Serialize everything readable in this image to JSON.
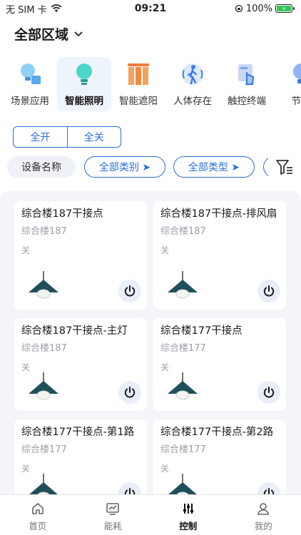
{
  "status": {
    "carrier": "无 SIM 卡",
    "time": "09:21",
    "battery": "100%"
  },
  "region": {
    "title": "全部区域"
  },
  "categories": [
    {
      "label": "场景应用",
      "icon": "scene-icon"
    },
    {
      "label": "智能照明",
      "icon": "bulb-icon",
      "active": true
    },
    {
      "label": "智能遮阳",
      "icon": "curtain-icon"
    },
    {
      "label": "人体存在",
      "icon": "person-presence-icon"
    },
    {
      "label": "触控终端",
      "icon": "touch-terminal-icon"
    },
    {
      "label": "节能",
      "icon": "energy-icon"
    }
  ],
  "switch_all": {
    "on": "全开",
    "off": "全关"
  },
  "filters": {
    "device_name": "设备名称",
    "category": "全部类别 ➤",
    "type": "全部类型 ➤"
  },
  "devices": [
    {
      "name": "综合楼187干接点",
      "location": "综合楼187",
      "state": "关"
    },
    {
      "name": "综合楼187干接点-排风扇",
      "location": "综合楼187",
      "state": "关"
    },
    {
      "name": "综合楼187干接点-主灯",
      "location": "综合楼187",
      "state": "关"
    },
    {
      "name": "综合楼177干接点",
      "location": "综合楼177",
      "state": "关"
    },
    {
      "name": "综合楼177干接点-第1路",
      "location": "综合楼177",
      "state": "关"
    },
    {
      "name": "综合楼177干接点-第2路",
      "location": "综合楼177",
      "state": "关"
    }
  ],
  "tabs": [
    {
      "label": "首页",
      "icon": "home-icon"
    },
    {
      "label": "能耗",
      "icon": "energy-chart-icon"
    },
    {
      "label": "控制",
      "icon": "control-sliders-icon",
      "active": true
    },
    {
      "label": "我的",
      "icon": "user-icon"
    }
  ],
  "colors": {
    "accent": "#2a6fdb",
    "card_bg": "#ffffff",
    "grid_bg": "#f3f5f9"
  }
}
